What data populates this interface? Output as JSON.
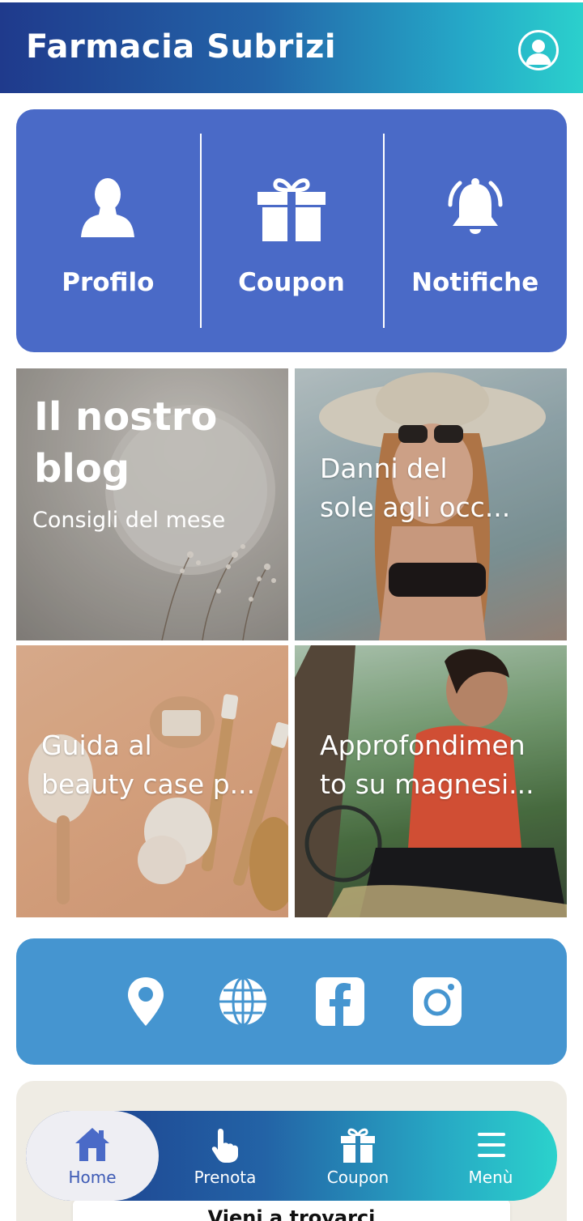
{
  "header": {
    "title": "Farmacia Subrizi",
    "profile_icon": "user-circle-icon"
  },
  "quick_actions": [
    {
      "label": "Profilo",
      "icon": "person-icon"
    },
    {
      "label": "Coupon",
      "icon": "gift-icon"
    },
    {
      "label": "Notifiche",
      "icon": "bell-icon"
    }
  ],
  "blog": {
    "title": "Il nostro blog",
    "title_line1": "Il nostro",
    "title_line2": "blog",
    "subtitle": "Consigli del mese",
    "articles": [
      {
        "line1": "Danni del",
        "line2": "sole agli occ..."
      },
      {
        "line1": "Guida al",
        "line2": "beauty case p..."
      },
      {
        "line1": "Approfondimen",
        "line2": "to su magnesi..."
      }
    ]
  },
  "social": {
    "icons": [
      "location-pin-icon",
      "globe-icon",
      "facebook-icon",
      "instagram-icon"
    ]
  },
  "visit": {
    "label": "Vieni a trovarci"
  },
  "nav": [
    {
      "label": "Home",
      "icon": "home-icon",
      "active": true
    },
    {
      "label": "Prenota",
      "icon": "hand-pointer-icon"
    },
    {
      "label": "Coupon",
      "icon": "gift-icon"
    },
    {
      "label": "Menù",
      "icon": "hamburger-menu-icon"
    }
  ],
  "colors": {
    "header_gradient": [
      "#1f3a8c",
      "#2bd0cc"
    ],
    "quick_bg": "#4a6ac7",
    "social_bg": "#4595d0",
    "nav_active_bg": "#eeeef3",
    "nav_active_text": "#3e5bb5"
  }
}
